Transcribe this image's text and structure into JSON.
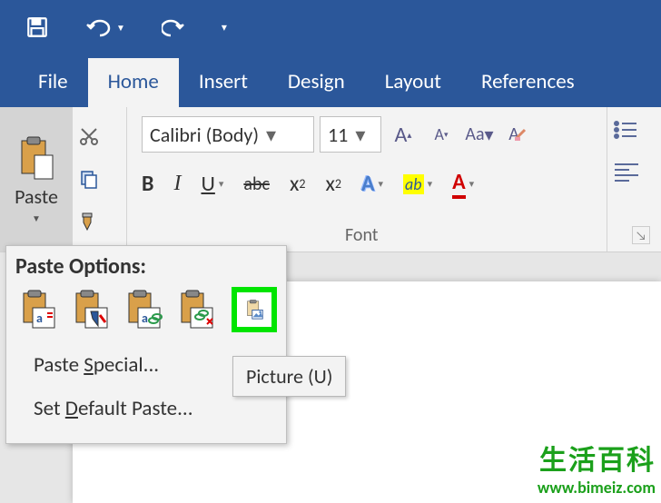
{
  "titlebar": {
    "save_icon": "save",
    "undo_icon": "undo",
    "redo_icon": "redo",
    "customize_icon": "customize"
  },
  "tabs": {
    "items": [
      "File",
      "Home",
      "Insert",
      "Design",
      "Layout",
      "References"
    ],
    "active_index": 1
  },
  "ribbon": {
    "paste": {
      "label": "Paste"
    },
    "clipboard_tools": {
      "cut": "cut",
      "copy": "copy",
      "format_painter": "format-painter"
    },
    "font": {
      "name": "Calibri (Body)",
      "size": "11",
      "grow": "A",
      "shrink": "A",
      "change_case": "Aa",
      "clear_format": "clear",
      "bold": "B",
      "italic": "I",
      "underline": "U",
      "strike": "abc",
      "sub": "x",
      "sub_s": "2",
      "sup": "x",
      "sup_s": "2",
      "text_effects": "A",
      "highlight": "ab",
      "font_color": "A",
      "group_label": "Font"
    },
    "paragraph": {
      "bullets": "bullets",
      "align_left": "align-left"
    }
  },
  "popup": {
    "title": "Paste Options:",
    "options": [
      "keep-source-formatting",
      "merge-formatting",
      "keep-link",
      "use-destination-styles",
      "picture"
    ],
    "highlighted_index": 4,
    "menu": {
      "paste_special": "Paste Special...",
      "paste_special_accel": "S",
      "set_default": "Set Default Paste...",
      "set_default_accel": "D"
    }
  },
  "tooltip": {
    "text": "Picture (U)"
  },
  "watermark": {
    "line1": "生活百科",
    "line2": "www.bimeiz.com"
  }
}
